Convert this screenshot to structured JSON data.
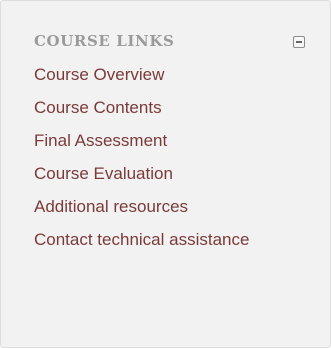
{
  "block": {
    "title": "COURSE LINKS",
    "collapse_icon": "minus-square-icon",
    "links": [
      {
        "label": "Course Overview"
      },
      {
        "label": "Course Contents"
      },
      {
        "label": "Final Assessment"
      },
      {
        "label": "Course Evaluation"
      },
      {
        "label": "Additional resources"
      },
      {
        "label": "Contact technical assistance"
      }
    ]
  },
  "colors": {
    "link": "#7b3a3a",
    "title": "#9a9a9a",
    "panel_background": "#f2f2f2"
  }
}
